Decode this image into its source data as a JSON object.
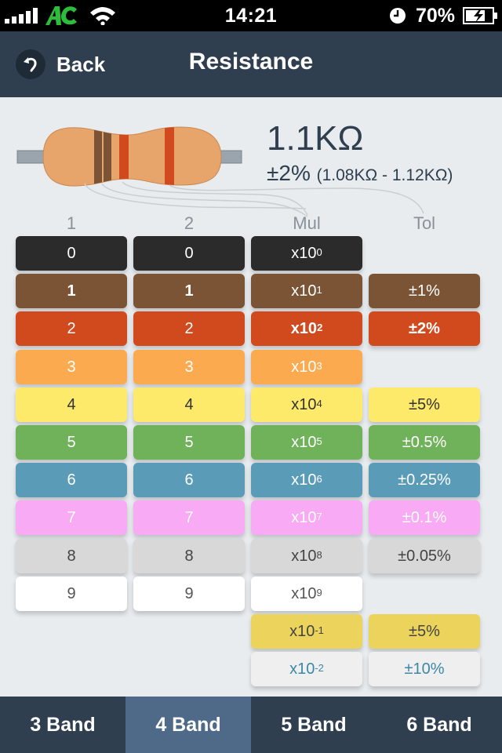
{
  "status_bar": {
    "time": "14:21",
    "battery_percent": "70%",
    "signal_icon": "signal-bars-icon",
    "carrier_icon": "carrier-logo-icon",
    "wifi_icon": "wifi-icon",
    "alarm_icon": "clock-icon",
    "battery_icon": "battery-charging-icon"
  },
  "nav": {
    "back_label": "Back",
    "title": "Resistance"
  },
  "result": {
    "value": "1.1KΩ",
    "tolerance": "±2%",
    "range": "(1.08KΩ - 1.12KΩ)"
  },
  "resistor_bands": [
    "#7b5436",
    "#7b5436",
    "#d14a1e",
    "#d14a1e"
  ],
  "columns": [
    {
      "heading": "1",
      "selected_index": 1,
      "items": [
        {
          "label": "0",
          "bg": "#2b2b2b",
          "fg": "#ffffff"
        },
        {
          "label": "1",
          "bg": "#7b5436",
          "fg": "#ffffff"
        },
        {
          "label": "2",
          "bg": "#d14a1e",
          "fg": "#ffffff"
        },
        {
          "label": "3",
          "bg": "#fbaa50",
          "fg": "#ffffff"
        },
        {
          "label": "4",
          "bg": "#fde96a",
          "fg": "#333333"
        },
        {
          "label": "5",
          "bg": "#6fb25a",
          "fg": "#ffffff"
        },
        {
          "label": "6",
          "bg": "#5a9cb8",
          "fg": "#ffffff"
        },
        {
          "label": "7",
          "bg": "#f8aaf4",
          "fg": "#ffffff"
        },
        {
          "label": "8",
          "bg": "#d8d8d8",
          "fg": "#444444"
        },
        {
          "label": "9",
          "bg": "#ffffff",
          "fg": "#555555"
        }
      ]
    },
    {
      "heading": "2",
      "selected_index": 1,
      "items": [
        {
          "label": "0",
          "bg": "#2b2b2b",
          "fg": "#ffffff"
        },
        {
          "label": "1",
          "bg": "#7b5436",
          "fg": "#ffffff"
        },
        {
          "label": "2",
          "bg": "#d14a1e",
          "fg": "#ffffff"
        },
        {
          "label": "3",
          "bg": "#fbaa50",
          "fg": "#ffffff"
        },
        {
          "label": "4",
          "bg": "#fde96a",
          "fg": "#333333"
        },
        {
          "label": "5",
          "bg": "#6fb25a",
          "fg": "#ffffff"
        },
        {
          "label": "6",
          "bg": "#5a9cb8",
          "fg": "#ffffff"
        },
        {
          "label": "7",
          "bg": "#f8aaf4",
          "fg": "#ffffff"
        },
        {
          "label": "8",
          "bg": "#d8d8d8",
          "fg": "#444444"
        },
        {
          "label": "9",
          "bg": "#ffffff",
          "fg": "#555555"
        }
      ]
    },
    {
      "heading": "Mul",
      "selected_index": 2,
      "items": [
        {
          "base": "x10",
          "exp": "0",
          "bg": "#2b2b2b",
          "fg": "#ffffff"
        },
        {
          "base": "x10",
          "exp": "1",
          "bg": "#7b5436",
          "fg": "#ffffff"
        },
        {
          "base": "x10",
          "exp": "2",
          "bg": "#d14a1e",
          "fg": "#ffffff"
        },
        {
          "base": "x10",
          "exp": "3",
          "bg": "#fbaa50",
          "fg": "#ffffff"
        },
        {
          "base": "x10",
          "exp": "4",
          "bg": "#fde96a",
          "fg": "#333333"
        },
        {
          "base": "x10",
          "exp": "5",
          "bg": "#6fb25a",
          "fg": "#ffffff"
        },
        {
          "base": "x10",
          "exp": "6",
          "bg": "#5a9cb8",
          "fg": "#ffffff"
        },
        {
          "base": "x10",
          "exp": "7",
          "bg": "#f8aaf4",
          "fg": "#ffffff"
        },
        {
          "base": "x10",
          "exp": "8",
          "bg": "#d8d8d8",
          "fg": "#444444"
        },
        {
          "base": "x10",
          "exp": "9",
          "bg": "#ffffff",
          "fg": "#555555"
        },
        {
          "base": "x10",
          "exp": "-1",
          "bg": "#ecd45c",
          "fg": "#444444"
        },
        {
          "base": "x10",
          "exp": "-2",
          "bg": "#efefef",
          "fg": "#3b88a6"
        }
      ]
    },
    {
      "heading": "Tol",
      "selected_index": 2,
      "items": [
        null,
        {
          "label": "±1%",
          "bg": "#7b5436",
          "fg": "#ffffff"
        },
        {
          "label": "±2%",
          "bg": "#d14a1e",
          "fg": "#ffffff"
        },
        null,
        {
          "label": "±5%",
          "bg": "#fde96a",
          "fg": "#333333"
        },
        {
          "label": "±0.5%",
          "bg": "#6fb25a",
          "fg": "#ffffff"
        },
        {
          "label": "±0.25%",
          "bg": "#5a9cb8",
          "fg": "#ffffff"
        },
        {
          "label": "±0.1%",
          "bg": "#f8aaf4",
          "fg": "#ffffff"
        },
        {
          "label": "±0.05%",
          "bg": "#d8d8d8",
          "fg": "#444444"
        },
        null,
        {
          "label": "±5%",
          "bg": "#ecd45c",
          "fg": "#444444"
        },
        {
          "label": "±10%",
          "bg": "#efefef",
          "fg": "#3b88a6"
        }
      ]
    }
  ],
  "tabs": [
    {
      "label": "3 Band",
      "active": false
    },
    {
      "label": "4 Band",
      "active": true
    },
    {
      "label": "5 Band",
      "active": false
    },
    {
      "label": "6 Band",
      "active": false
    }
  ]
}
